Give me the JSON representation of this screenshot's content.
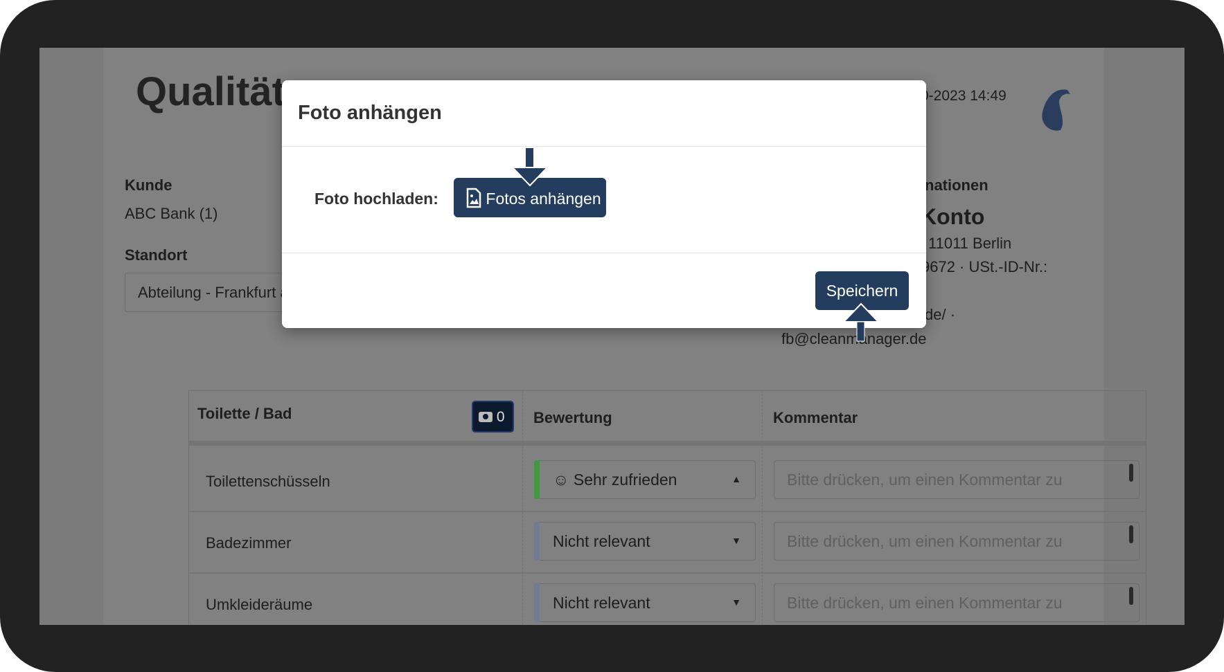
{
  "background_page": {
    "title_partial": "Qualitäts",
    "datetime_partial": "0-2023 14:49",
    "logo_icon": "feather-logo",
    "customer_label": "Kunde",
    "customer_value": "ABC Bank (1)",
    "location_label": "Standort",
    "location_value": "Abteilung - Frankfurt a",
    "info_heading_partial": "nationen",
    "company_partial": "Konto",
    "address_partial": "11011 Berlin",
    "tax_partial": "9672 · USt.-ID-Nr.:",
    "website_partial": "de/ ·",
    "email": "fb@cleanmanager.de",
    "table": {
      "section": "Toilette / Bad",
      "photo_count": "0",
      "col_rating": "Bewertung",
      "col_comment": "Kommentar",
      "rows": [
        {
          "name": "Toilettenschüsseln",
          "rating": "Sehr zufrieden",
          "rating_icon": "smiley",
          "rating_color": "#3f9a3f",
          "caret": "▲",
          "comment_placeholder": "Bitte drücken, um einen Kommentar zu"
        },
        {
          "name": "Badezimmer",
          "rating": "Nicht relevant",
          "rating_color": "#6f7c92",
          "caret": "▼",
          "comment_placeholder": "Bitte drücken, um einen Kommentar zu"
        },
        {
          "name": "Umkleideräume",
          "rating": "Nicht relevant",
          "rating_color": "#6f7c92",
          "caret": "▼",
          "comment_placeholder": "Bitte drücken, um einen Kommentar zu"
        }
      ]
    }
  },
  "modal": {
    "title": "Foto anhängen",
    "upload_label": "Foto hochladen:",
    "attach_button": "Fotos anhängen",
    "save_button": "Speichern"
  },
  "colors": {
    "primary": "#243c5e",
    "overlay": "#7b7b7b"
  }
}
